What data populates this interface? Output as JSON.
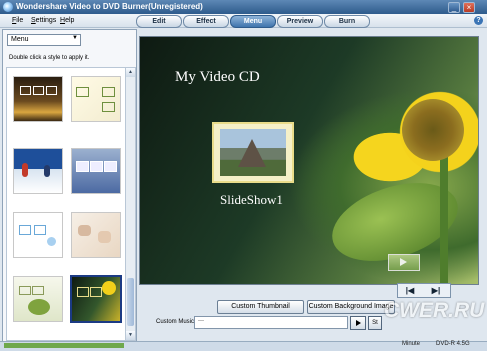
{
  "window": {
    "title": "Wondershare Video to DVD Burner(Unregistered)"
  },
  "menubar": [
    "File",
    "Settings",
    "Help"
  ],
  "tabs": [
    {
      "label": "Edit",
      "active": false
    },
    {
      "label": "Effect",
      "active": false
    },
    {
      "label": "Menu",
      "active": true
    },
    {
      "label": "Preview",
      "active": false
    },
    {
      "label": "Burn",
      "active": false
    }
  ],
  "left_panel": {
    "dropdown_value": "Menu",
    "hint": "Double click a style to apply it."
  },
  "preview": {
    "menu_title": "My Video CD",
    "slide_caption": "SlideShow1"
  },
  "buttons": {
    "custom_thumbnail": "Custom Thumbnail",
    "custom_background": "Custom Background Image",
    "custom_music_label": "Custom Music :",
    "custom_music_value": "---",
    "stop_label": "St"
  },
  "status": {
    "minute_label": "Minute",
    "disc": "DVD-R 4.5G"
  },
  "watermark": "CWER.RU",
  "colors": {
    "accent": "#3f74ad",
    "selection": "#1b3a84",
    "capacity": "#6fa84c"
  }
}
